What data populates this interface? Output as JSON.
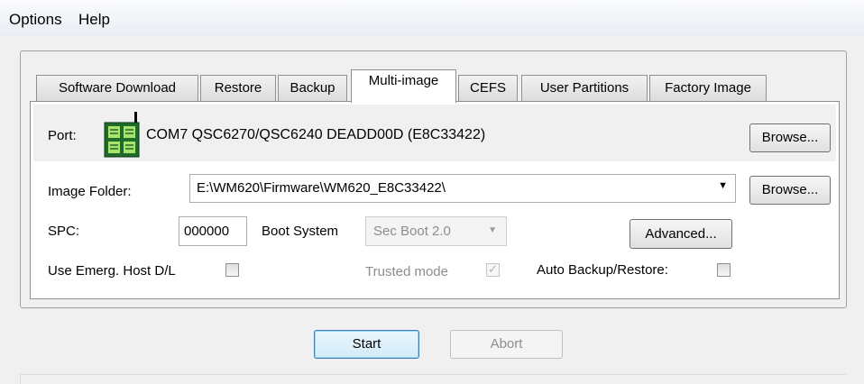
{
  "menu": {
    "options": "Options",
    "help": "Help"
  },
  "tabs": [
    {
      "label": "Software Download"
    },
    {
      "label": "Restore"
    },
    {
      "label": "Backup"
    },
    {
      "label": "Multi-image"
    },
    {
      "label": "CEFS"
    },
    {
      "label": "User Partitions"
    },
    {
      "label": "Factory Image"
    }
  ],
  "active_tab": "Multi-image",
  "port": {
    "label": "Port:",
    "value": "COM7  QSC6270/QSC6240  DEADD00D  (E8C33422)",
    "browse": "Browse...",
    "icon": "phone-device-icon"
  },
  "image_folder": {
    "label": "Image Folder:",
    "value": "E:\\WM620\\Firmware\\WM620_E8C33422\\",
    "browse": "Browse..."
  },
  "spc": {
    "label": "SPC:",
    "value": "000000"
  },
  "boot_system": {
    "label": "Boot System",
    "value": "Sec Boot 2.0"
  },
  "advanced_button": "Advanced...",
  "emerg_host": {
    "label": "Use Emerg. Host D/L",
    "checked": false
  },
  "trusted_mode": {
    "label": "Trusted mode",
    "checked": true,
    "disabled": true
  },
  "auto_backup": {
    "label": "Auto Backup/Restore:",
    "checked": false
  },
  "actions": {
    "start": "Start",
    "abort": "Abort"
  },
  "colors": {
    "start_border": "#3c7fb1",
    "disabled_text": "#8d8d8d"
  }
}
